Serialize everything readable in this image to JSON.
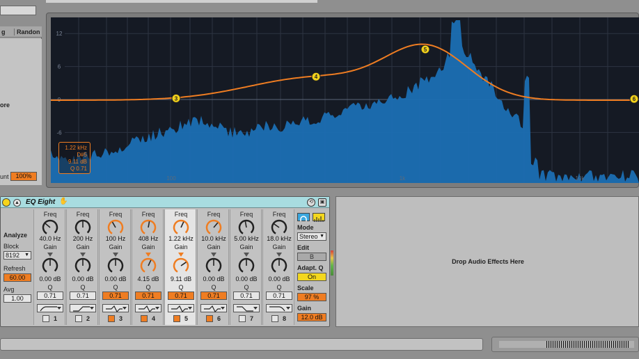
{
  "left_panel": {
    "col1": "g",
    "col2": "Randon",
    "more": "ore",
    "amount_label": "unt",
    "amount_value": "100%"
  },
  "spectrum": {
    "y_ticks": [
      "12",
      "6",
      "0",
      "-6"
    ],
    "x_ticks": [
      "100",
      "1k",
      "10k"
    ],
    "info": {
      "freq": "1.22 kHz",
      "note": "D#5",
      "gain": "9.11 dB",
      "q": "Q 0.71"
    },
    "colors": {
      "bg": "#151a24",
      "spectrum": "#1b6fb4",
      "curve": "#ef7d22",
      "point": "#f2d11b"
    }
  },
  "device": {
    "title": "EQ Eight",
    "analyze": {
      "label": "Analyze",
      "block_label": "Block",
      "block_value": "8192",
      "refresh_label": "Refresh",
      "refresh_value": "60.00",
      "avg_label": "Avg",
      "avg_value": "1.00"
    },
    "freq_label": "Freq",
    "gain_label": "Gain",
    "q_label": "Q",
    "bands": [
      {
        "num": "1",
        "freq": "40.0 Hz",
        "gain": "0.00 dB",
        "q": "0.71",
        "on": false,
        "shape": "lowcut"
      },
      {
        "num": "2",
        "freq": "200 Hz",
        "gain": "0.00 dB",
        "q": "0.71",
        "on": false,
        "shape": "lowshelf"
      },
      {
        "num": "3",
        "freq": "100 Hz",
        "gain": "0.00 dB",
        "q": "0.71",
        "on": true,
        "shape": "bell"
      },
      {
        "num": "4",
        "freq": "408 Hz",
        "gain": "4.15 dB",
        "q": "0.71",
        "on": true,
        "shape": "bell"
      },
      {
        "num": "5",
        "freq": "1.22 kHz",
        "gain": "9.11 dB",
        "q": "0.71",
        "on": true,
        "shape": "bell"
      },
      {
        "num": "6",
        "freq": "10.0 kHz",
        "gain": "0.00 dB",
        "q": "0.71",
        "on": true,
        "shape": "bell"
      },
      {
        "num": "7",
        "freq": "5.00 kHz",
        "gain": "0.00 dB",
        "q": "0.71",
        "on": false,
        "shape": "highshelf"
      },
      {
        "num": "8",
        "freq": "18.0 kHz",
        "gain": "0.00 dB",
        "q": "0.71",
        "on": false,
        "shape": "highcut"
      }
    ],
    "right": {
      "mode_label": "Mode",
      "mode_value": "Stereo",
      "edit_label": "Edit",
      "edit_value": "B",
      "adapt_label": "Adapt. Q",
      "adapt_value": "On",
      "scale_label": "Scale",
      "scale_value": "97 %",
      "gain_label": "Gain",
      "gain_value": "12.0 dB"
    }
  },
  "drop_zone": {
    "text": "Drop Audio Effects Here"
  }
}
